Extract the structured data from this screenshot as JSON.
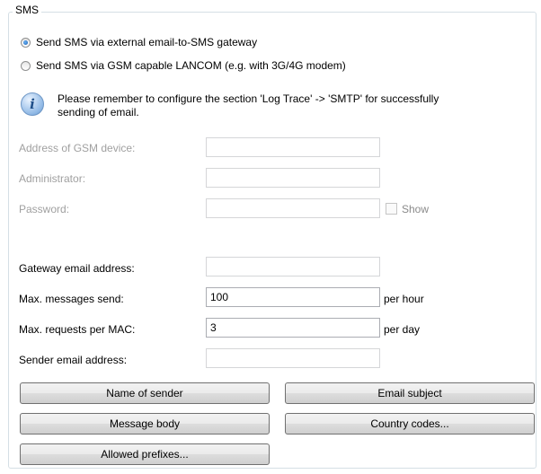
{
  "group": {
    "title": "SMS"
  },
  "radios": [
    {
      "label": "Send SMS via external email-to-SMS gateway",
      "checked": true
    },
    {
      "label": "Send SMS via GSM capable LANCOM (e.g. with 3G/4G modem)",
      "checked": false
    }
  ],
  "info": {
    "line1": "Please remember to configure the section 'Log  Trace' -> 'SMTP' for successfully",
    "line2": "sending of email."
  },
  "gsm": {
    "address_label": "Address of GSM device:",
    "address_value": "",
    "admin_label": "Administrator:",
    "admin_value": "",
    "password_label": "Password:",
    "password_value": "",
    "show_label": "Show"
  },
  "gateway": {
    "email_label": "Gateway email address:",
    "email_value": "",
    "max_messages_label": "Max. messages send:",
    "max_messages_value": "100",
    "max_messages_unit": "per hour",
    "max_requests_label": "Max. requests per MAC:",
    "max_requests_value": "3",
    "max_requests_unit": "per day",
    "sender_label": "Sender email address:",
    "sender_value": ""
  },
  "buttons": {
    "name_of_sender": "Name of sender",
    "email_subject": "Email subject",
    "message_body": "Message body",
    "country_codes": "Country codes...",
    "allowed_prefixes": "Allowed prefixes..."
  }
}
